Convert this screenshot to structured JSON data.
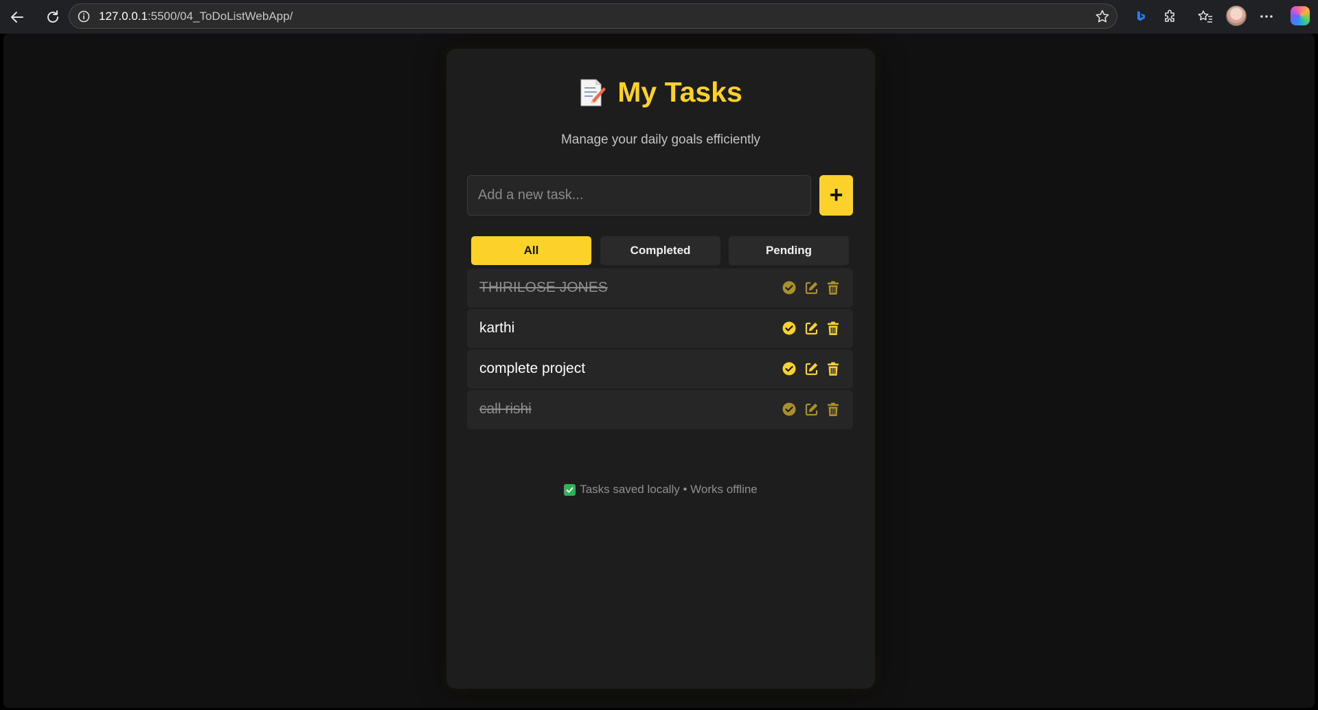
{
  "browser": {
    "url_host": "127.0.0.1",
    "url_rest": ":5500/04_ToDoListWebApp/"
  },
  "app": {
    "title": "My Tasks",
    "subtitle": "Manage your daily goals efficiently",
    "input_placeholder": "Add a new task...",
    "add_button_label": "+",
    "accent_color": "#fcd22a",
    "filters": [
      {
        "label": "All",
        "active": true
      },
      {
        "label": "Completed",
        "active": false
      },
      {
        "label": "Pending",
        "active": false
      }
    ],
    "tasks": [
      {
        "text": "THIRILOSE JONES",
        "completed": true
      },
      {
        "text": "karthi",
        "completed": false
      },
      {
        "text": "complete project",
        "completed": false
      },
      {
        "text": "call rishi",
        "completed": true
      }
    ],
    "task_action_icons": [
      "check-circle-icon",
      "edit-icon",
      "trash-icon"
    ],
    "footer_note": "Tasks saved locally • Works offline"
  }
}
